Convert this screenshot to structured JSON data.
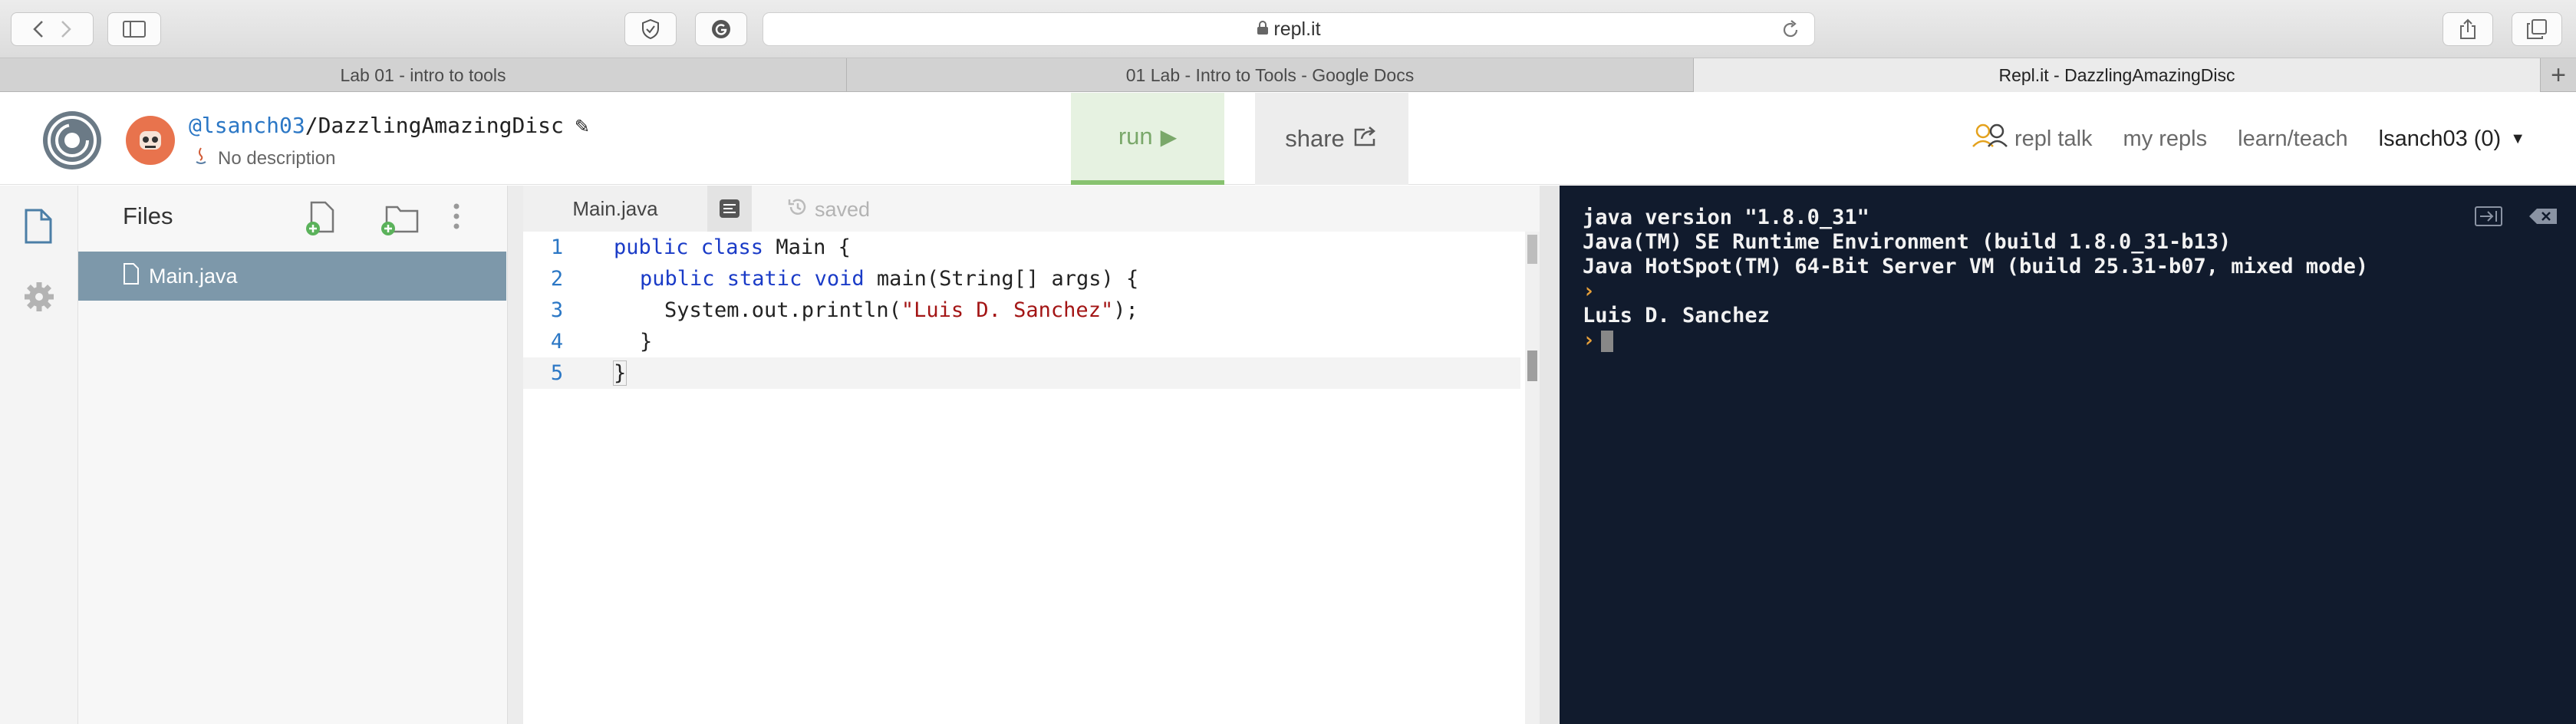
{
  "browser": {
    "address": "repl.it",
    "tabs": [
      {
        "label": "Lab 01 - intro to tools",
        "active": false
      },
      {
        "label": "01 Lab - Intro to Tools - Google Docs",
        "active": false
      },
      {
        "label": "Repl.it - DazzlingAmazingDisc",
        "active": true
      }
    ],
    "new_tab_label": "+"
  },
  "header": {
    "user": "@lsanch03",
    "separator": "/",
    "repl_name": "DazzlingAmazingDisc",
    "description": "No description",
    "run_label": "run",
    "share_label": "share",
    "nav": {
      "repl_talk": "repl talk",
      "my_repls": "my repls",
      "learn_teach": "learn/teach",
      "account": "lsanch03 (0)"
    }
  },
  "files": {
    "title": "Files",
    "items": [
      {
        "name": "Main.java",
        "selected": true
      }
    ]
  },
  "editor": {
    "tab_label": "Main.java",
    "status": "saved",
    "lines": [
      {
        "no": "1"
      },
      {
        "no": "2"
      },
      {
        "no": "3"
      },
      {
        "no": "4"
      },
      {
        "no": "5"
      }
    ],
    "code": {
      "l1_kw": "public class",
      "l1_rest": " Main {",
      "l2_kw": "public static void",
      "l2_rest": " main(String[] args) {",
      "l3_pre": "System.out.println(",
      "l3_str": "\"Luis D. Sanchez\"",
      "l3_post": ");",
      "l4": "}",
      "l5": "}"
    }
  },
  "console": {
    "lines": [
      "java version \"1.8.0_31\"",
      "Java(TM) SE Runtime Environment (build 1.8.0_31-b13)",
      "Java HotSpot(TM) 64-Bit Server VM (build 25.31-b07, mixed mode)"
    ],
    "prompt": "›",
    "output": "Luis D. Sanchez"
  },
  "colors": {
    "run_bg": "#e6f2e1",
    "file_selected_bg": "#7d98aa",
    "console_bg": "#111b2d",
    "link_blue": "#2b77c5"
  }
}
